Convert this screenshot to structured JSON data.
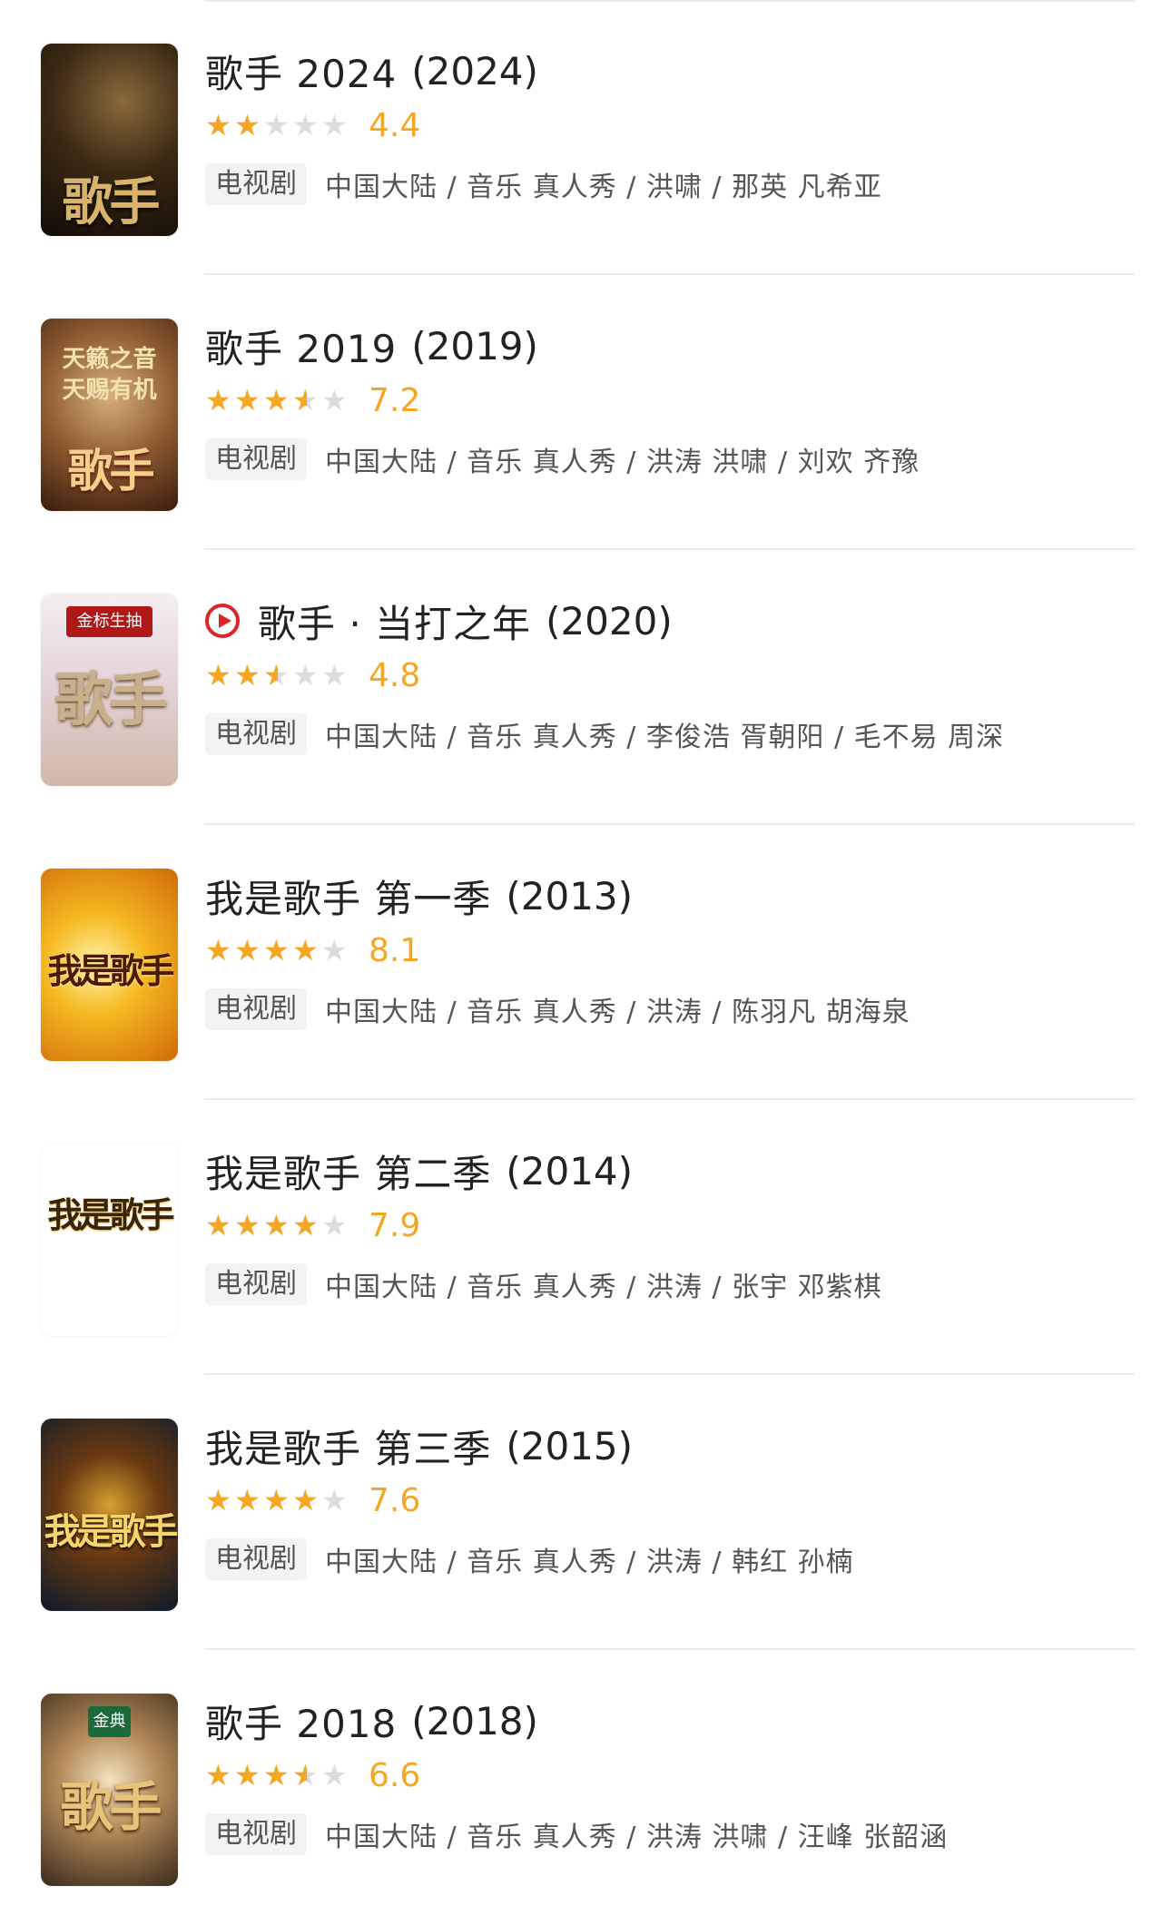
{
  "colors": {
    "star_filled": "#f5a623",
    "star_empty": "#dcdcdc",
    "score": "#f5a623",
    "play_icon": "#e02424",
    "badge_bg": "#f3f3f3",
    "text_primary": "#222222",
    "text_secondary": "#555555",
    "divider": "#ebebeb"
  },
  "items": [
    {
      "title": "歌手 2024",
      "year": "(2024)",
      "stars": 2,
      "score": "4.4",
      "type": "电视剧",
      "meta": "中国大陆 / 音乐 真人秀 / 洪啸 / 那英 凡希亚",
      "poster_text": "歌手",
      "playable": false
    },
    {
      "title": "歌手 2019",
      "year": "(2019)",
      "stars": 3.5,
      "score": "7.2",
      "type": "电视剧",
      "meta": "中国大陆 / 音乐 真人秀 / 洪涛 洪啸 / 刘欢 齐豫",
      "poster_text": "歌手",
      "poster_sub": "天籁之音 天赐有机",
      "playable": false
    },
    {
      "title": "歌手 · 当打之年",
      "year": "(2020)",
      "stars": 2.5,
      "score": "4.8",
      "type": "电视剧",
      "meta": "中国大陆 / 音乐 真人秀 / 李俊浩 胥朝阳 / 毛不易 周深",
      "poster_text": "歌手",
      "poster_tag": "金标生抽",
      "playable": true
    },
    {
      "title": "我是歌手 第一季",
      "year": "(2013)",
      "stars": 4,
      "score": "8.1",
      "type": "电视剧",
      "meta": "中国大陆 / 音乐 真人秀 / 洪涛 / 陈羽凡 胡海泉",
      "poster_text": "我是歌手",
      "playable": false
    },
    {
      "title": "我是歌手 第二季",
      "year": "(2014)",
      "stars": 4,
      "score": "7.9",
      "type": "电视剧",
      "meta": "中国大陆 / 音乐 真人秀 / 洪涛 / 张宇 邓紫棋",
      "poster_text": "我是歌手",
      "playable": false
    },
    {
      "title": "我是歌手 第三季",
      "year": "(2015)",
      "stars": 4,
      "score": "7.6",
      "type": "电视剧",
      "meta": "中国大陆 / 音乐 真人秀 / 洪涛 / 韩红 孙楠",
      "poster_text": "我是歌手",
      "playable": false
    },
    {
      "title": "歌手 2018",
      "year": "(2018)",
      "stars": 3.5,
      "score": "6.6",
      "type": "电视剧",
      "meta": "中国大陆 / 音乐 真人秀 / 洪涛 洪啸 / 汪峰 张韶涵",
      "poster_text": "歌手",
      "poster_tag": "金典",
      "playable": false
    }
  ]
}
